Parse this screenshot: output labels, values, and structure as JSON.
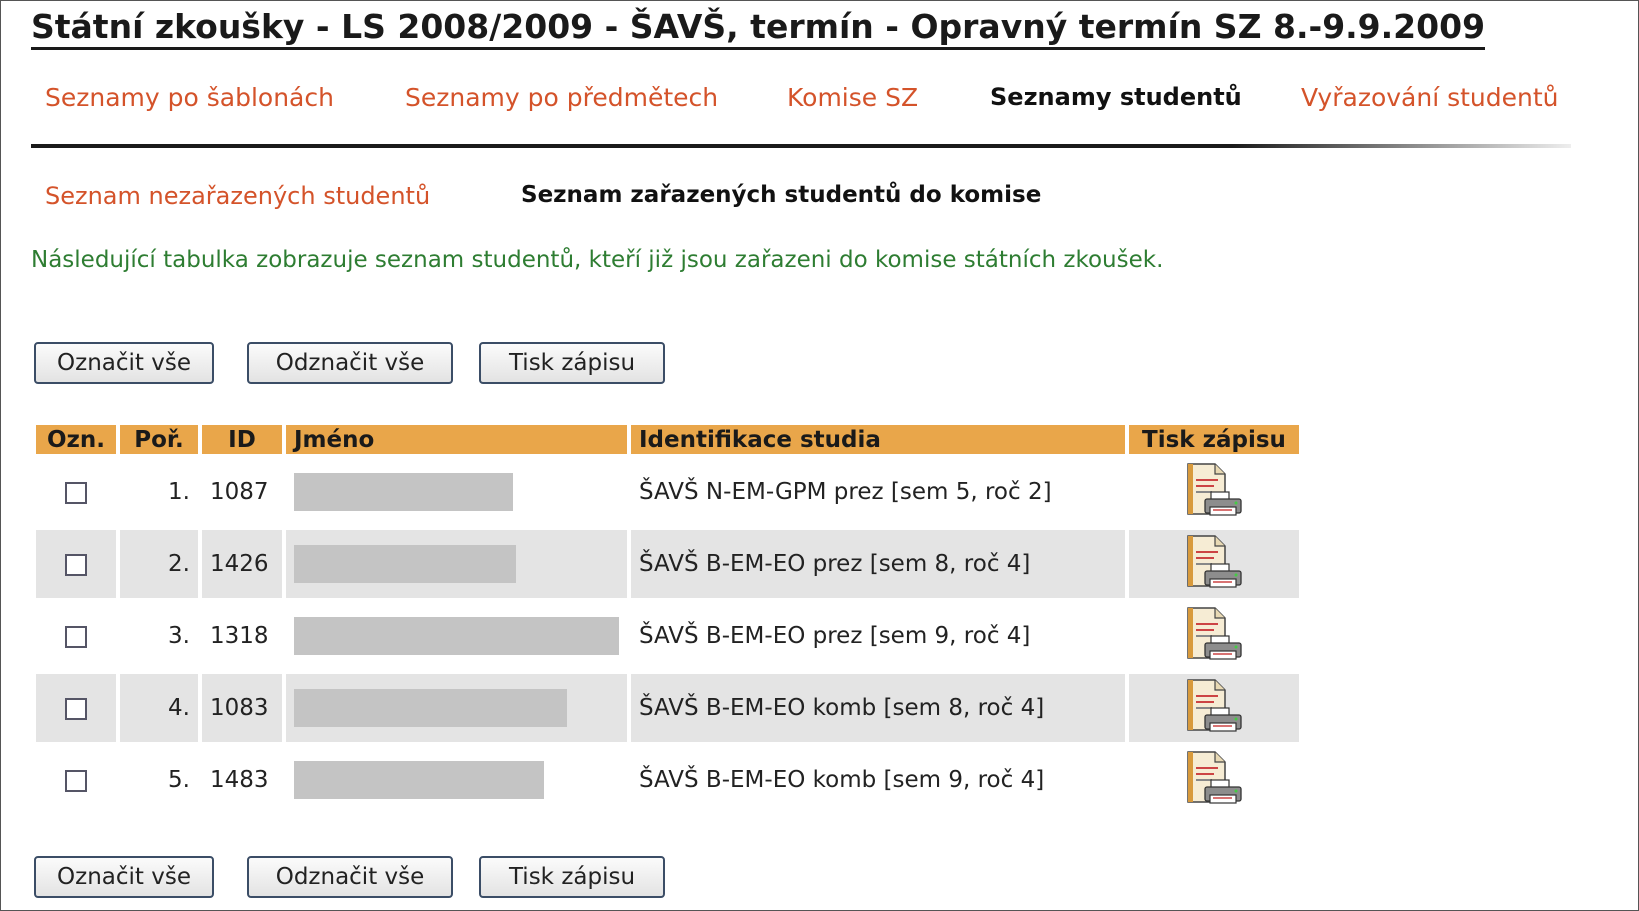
{
  "page": {
    "title": "Státní zkoušky - LS 2008/2009 - ŠAVŠ, termín - Opravný termín SZ 8.-9.9.2009"
  },
  "tabs": [
    {
      "label": "Seznamy po šablonách",
      "active": false
    },
    {
      "label": "Seznamy po předmětech",
      "active": false
    },
    {
      "label": "Komise SZ",
      "active": false
    },
    {
      "label": "Seznamy studentů",
      "active": true
    },
    {
      "label": "Vyřazování studentů",
      "active": false
    }
  ],
  "subtabs": [
    {
      "label": "Seznam nezařazených studentů",
      "active": false
    },
    {
      "label": "Seznam zařazených studentů do komise",
      "active": true
    }
  ],
  "description": "Následující tabulka zobrazuje seznam studentů, kteří již jsou zařazeni do komise státních zkoušek.",
  "buttons": {
    "select_all": "Označit vše",
    "deselect_all": "Odznačit vše",
    "print": "Tisk zápisu"
  },
  "table": {
    "headers": {
      "mark": "Ozn.",
      "order": "Poř.",
      "id": "ID",
      "name": "Jméno",
      "study": "Identifikace studia",
      "print": "Tisk zápisu"
    },
    "rows": [
      {
        "order": "1.",
        "id": "1087",
        "study": "ŠAVŠ N-EM-GPM prez [sem 5, roč 2]",
        "checked": false
      },
      {
        "order": "2.",
        "id": "1426",
        "study": "ŠAVŠ B-EM-EO prez [sem 8, roč 4]",
        "checked": false
      },
      {
        "order": "3.",
        "id": "1318",
        "study": "ŠAVŠ B-EM-EO prez [sem 9, roč 4]",
        "checked": false
      },
      {
        "order": "4.",
        "id": "1083",
        "study": "ŠAVŠ B-EM-EO komb [sem 8, roč 4]",
        "checked": false
      },
      {
        "order": "5.",
        "id": "1483",
        "study": "ŠAVŠ B-EM-EO komb [sem 9, roč 4]",
        "checked": false
      }
    ]
  },
  "colors": {
    "link": "#d4532a",
    "header_bg": "#e9a64a",
    "description_text": "#2e7d32",
    "alt_row_bg": "#e4e4e4"
  }
}
